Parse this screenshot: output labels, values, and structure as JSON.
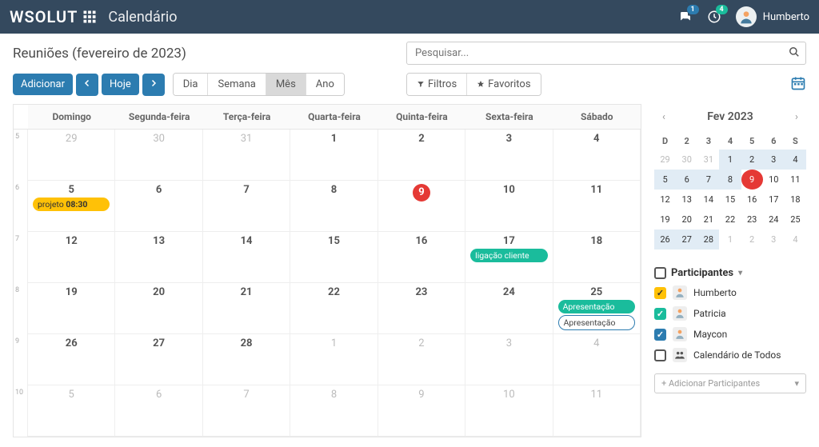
{
  "navbar": {
    "brand": "WSOLUT",
    "app": "Calendário",
    "badges": {
      "messages": "1",
      "activities": "4"
    },
    "user": "Humberto"
  },
  "titlebar": {
    "title": "Reuniões (fevereiro de 2023)",
    "search_placeholder": "Pesquisar..."
  },
  "toolbar": {
    "add": "Adicionar",
    "today": "Hoje",
    "views": {
      "day": "Dia",
      "week": "Semana",
      "month": "Mês",
      "year": "Ano"
    },
    "filters": "Filtros",
    "favorites": "Favoritos"
  },
  "calendar": {
    "dow": [
      "Domingo",
      "Segunda-feira",
      "Terça-feira",
      "Quarta-feira",
      "Quinta-feira",
      "Sexta-feira",
      "Sábado"
    ],
    "week_numbers": [
      "5",
      "6",
      "7",
      "8",
      "9",
      "10"
    ],
    "grid": [
      [
        {
          "n": "29",
          "other": true
        },
        {
          "n": "30",
          "other": true
        },
        {
          "n": "31",
          "other": true
        },
        {
          "n": "1"
        },
        {
          "n": "2"
        },
        {
          "n": "3"
        },
        {
          "n": "4"
        }
      ],
      [
        {
          "n": "5",
          "events": [
            {
              "label": "projeto",
              "time": "08:30",
              "style": "yellow"
            }
          ]
        },
        {
          "n": "6"
        },
        {
          "n": "7"
        },
        {
          "n": "8"
        },
        {
          "n": "9",
          "today": true
        },
        {
          "n": "10"
        },
        {
          "n": "11"
        }
      ],
      [
        {
          "n": "12"
        },
        {
          "n": "13"
        },
        {
          "n": "14"
        },
        {
          "n": "15"
        },
        {
          "n": "16"
        },
        {
          "n": "17",
          "events": [
            {
              "label": "ligação cliente",
              "style": "teal"
            }
          ]
        },
        {
          "n": "18"
        }
      ],
      [
        {
          "n": "19"
        },
        {
          "n": "20"
        },
        {
          "n": "21"
        },
        {
          "n": "22"
        },
        {
          "n": "23"
        },
        {
          "n": "24"
        },
        {
          "n": "25",
          "events": [
            {
              "label": "Apresentação",
              "style": "teal"
            },
            {
              "label": "Apresentação",
              "style": "outline"
            }
          ]
        }
      ],
      [
        {
          "n": "26"
        },
        {
          "n": "27"
        },
        {
          "n": "28"
        },
        {
          "n": "1",
          "other": true
        },
        {
          "n": "2",
          "other": true
        },
        {
          "n": "3",
          "other": true
        },
        {
          "n": "4",
          "other": true
        }
      ],
      [
        {
          "n": "5",
          "other": true
        },
        {
          "n": "6",
          "other": true
        },
        {
          "n": "7",
          "other": true
        },
        {
          "n": "8",
          "other": true
        },
        {
          "n": "9",
          "other": true
        },
        {
          "n": "10",
          "other": true
        },
        {
          "n": "11",
          "other": true
        }
      ]
    ]
  },
  "mini": {
    "label": "Fev 2023",
    "dow": [
      "D",
      "2",
      "3",
      "4",
      "5",
      "6",
      "S"
    ],
    "rows": [
      [
        {
          "n": "29",
          "other": true
        },
        {
          "n": "30",
          "other": true
        },
        {
          "n": "31",
          "other": true
        },
        {
          "n": "1",
          "shade": true
        },
        {
          "n": "2",
          "shade": true
        },
        {
          "n": "3",
          "shade": true
        },
        {
          "n": "4",
          "shade": true
        }
      ],
      [
        {
          "n": "5",
          "shade": true
        },
        {
          "n": "6",
          "shade": true
        },
        {
          "n": "7",
          "shade": true
        },
        {
          "n": "8",
          "shade": true
        },
        {
          "n": "9",
          "today": true
        },
        {
          "n": "10"
        },
        {
          "n": "11"
        }
      ],
      [
        {
          "n": "12"
        },
        {
          "n": "13"
        },
        {
          "n": "14"
        },
        {
          "n": "15"
        },
        {
          "n": "16"
        },
        {
          "n": "17"
        },
        {
          "n": "18"
        }
      ],
      [
        {
          "n": "19"
        },
        {
          "n": "20"
        },
        {
          "n": "21"
        },
        {
          "n": "22"
        },
        {
          "n": "23"
        },
        {
          "n": "24"
        },
        {
          "n": "25"
        }
      ],
      [
        {
          "n": "26",
          "shade": true
        },
        {
          "n": "27",
          "shade": true
        },
        {
          "n": "28",
          "shade": true
        },
        {
          "n": "1",
          "other": true
        },
        {
          "n": "2",
          "other": true
        },
        {
          "n": "3",
          "other": true
        },
        {
          "n": "4",
          "other": true
        }
      ]
    ]
  },
  "participants": {
    "header": "Participantes",
    "list": [
      {
        "name": "Humberto",
        "color": "yellow",
        "checked": true
      },
      {
        "name": "Patricia",
        "color": "teal",
        "checked": true
      },
      {
        "name": "Maycon",
        "color": "blue",
        "checked": true
      },
      {
        "name": "Calendário de Todos",
        "color": "",
        "checked": false,
        "everyone": true
      }
    ],
    "add": "+ Adicionar Participantes"
  }
}
